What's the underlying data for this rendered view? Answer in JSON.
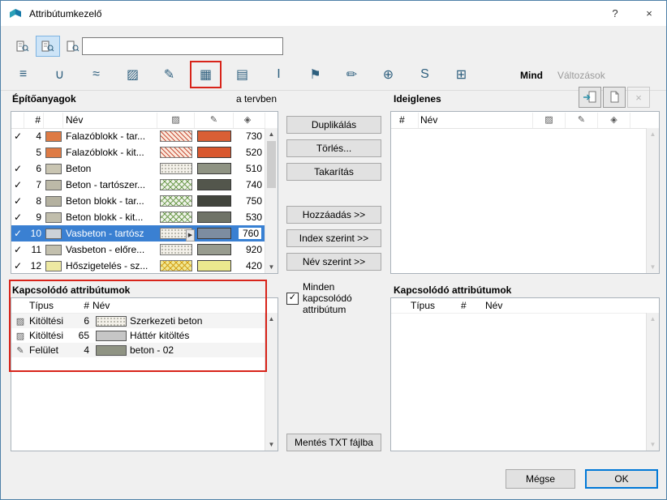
{
  "window": {
    "title": "Attribútumkezelő",
    "help_label": "?",
    "close_label": "×"
  },
  "icons": {
    "check": "✓",
    "dropdown": "▶",
    "up": "▲",
    "down": "▼",
    "fill_header": "▨",
    "surface_header": "✎",
    "pen_header": "◈",
    "delete_x": "×"
  },
  "tabs": {
    "items": [
      {
        "name": "layers",
        "glyph": "≡"
      },
      {
        "name": "pens",
        "glyph": "∪"
      },
      {
        "name": "line-types",
        "glyph": "≈"
      },
      {
        "name": "fill-types",
        "glyph": "▨"
      },
      {
        "name": "surfaces",
        "glyph": "✎"
      },
      {
        "name": "building-materials",
        "glyph": "▦",
        "highlighted": true
      },
      {
        "name": "composites",
        "glyph": "▤"
      },
      {
        "name": "profiles",
        "glyph": "I"
      },
      {
        "name": "zones",
        "glyph": "⚑"
      },
      {
        "name": "markers",
        "glyph": "✏"
      },
      {
        "name": "cities",
        "glyph": "⊕"
      },
      {
        "name": "operation-profiles",
        "glyph": "S"
      },
      {
        "name": "mep-systems",
        "glyph": "⊞"
      }
    ],
    "all_label": "Mind",
    "changes_label": "Változások"
  },
  "materials": {
    "title": "Építőanyagok",
    "scope_label": "a tervben",
    "columns": {
      "num": "#",
      "name": "Név"
    },
    "rows": [
      {
        "checked": true,
        "num": "4",
        "name": "Falazóblokk - tar...",
        "color": "#de7b45",
        "fill": "diag-red",
        "surface": "#d95f35",
        "value": "730"
      },
      {
        "checked": false,
        "num": "5",
        "name": "Falazóblokk - kit...",
        "color": "#de7b45",
        "fill": "diag-red",
        "surface": "#d9572e",
        "value": "520"
      },
      {
        "checked": true,
        "num": "6",
        "name": "Beton",
        "color": "#c9c5b2",
        "fill": "stipple",
        "surface": "#8f9383",
        "value": "510"
      },
      {
        "checked": true,
        "num": "7",
        "name": "Beton - tartószer...",
        "color": "#bcb9a8",
        "fill": "cross-green",
        "surface": "#53564c",
        "value": "740"
      },
      {
        "checked": true,
        "num": "8",
        "name": "Beton blokk - tar...",
        "color": "#b4b1a0",
        "fill": "cross-green",
        "surface": "#42453d",
        "value": "750"
      },
      {
        "checked": true,
        "num": "9",
        "name": "Beton blokk - kit...",
        "color": "#c1beac",
        "fill": "cross-green",
        "surface": "#6f7367",
        "value": "530"
      },
      {
        "checked": true,
        "num": "10",
        "name": "Vasbeton - tartósz",
        "color": "#ccd2d8",
        "fill": "stipple",
        "surface": "#7d8da0",
        "value": "760",
        "selected": true,
        "dropdown": true
      },
      {
        "checked": true,
        "num": "11",
        "name": "Vasbeton - előre...",
        "color": "#c3c0ae",
        "fill": "stipple",
        "surface": "#989c8f",
        "value": "920"
      },
      {
        "checked": true,
        "num": "12",
        "name": "Hőszigetelés - sz...",
        "color": "#eee9a2",
        "fill": "cross-yellow",
        "surface": "#ebe88e",
        "value": "420"
      }
    ]
  },
  "linked": {
    "title": "Kapcsolódó attribútumok",
    "columns": {
      "type": "Típus",
      "num": "#",
      "name": "Név"
    },
    "rows": [
      {
        "icon": "fill-type-icon",
        "glyph": "▨",
        "type": "Kitöltési",
        "num": "6",
        "pattern": "stipple",
        "name": "Szerkezeti beton"
      },
      {
        "icon": "fill-type-icon",
        "glyph": "▨",
        "type": "Kitöltési",
        "num": "65",
        "color": "#c6c6c6",
        "name": "Háttér kitöltés"
      },
      {
        "icon": "surface-icon",
        "glyph": "✎",
        "type": "Felület",
        "num": "4",
        "color": "#8f9383",
        "name": "beton - 02"
      }
    ]
  },
  "actions": {
    "duplicate": "Duplikálás",
    "delete": "Törlés...",
    "purge": "Takarítás",
    "append": "Hozzáadás >>",
    "by_index": "Index szerint >>",
    "by_name": "Név szerint >>",
    "all_linked_label": "Minden kapcsolódó attribútum",
    "save_txt": "Mentés TXT fájlba"
  },
  "temp": {
    "title": "Ideiglenes",
    "columns": {
      "num": "#",
      "name": "Név"
    },
    "linked_title": "Kapcsolódó attribútumok",
    "linked_columns": {
      "type": "Típus",
      "num": "#",
      "name": "Név"
    }
  },
  "footer": {
    "cancel": "Mégse",
    "ok": "OK"
  },
  "colors": {
    "accent": "#0078d7",
    "selection": "#3a80d2",
    "highlight_box": "#d8241a"
  }
}
